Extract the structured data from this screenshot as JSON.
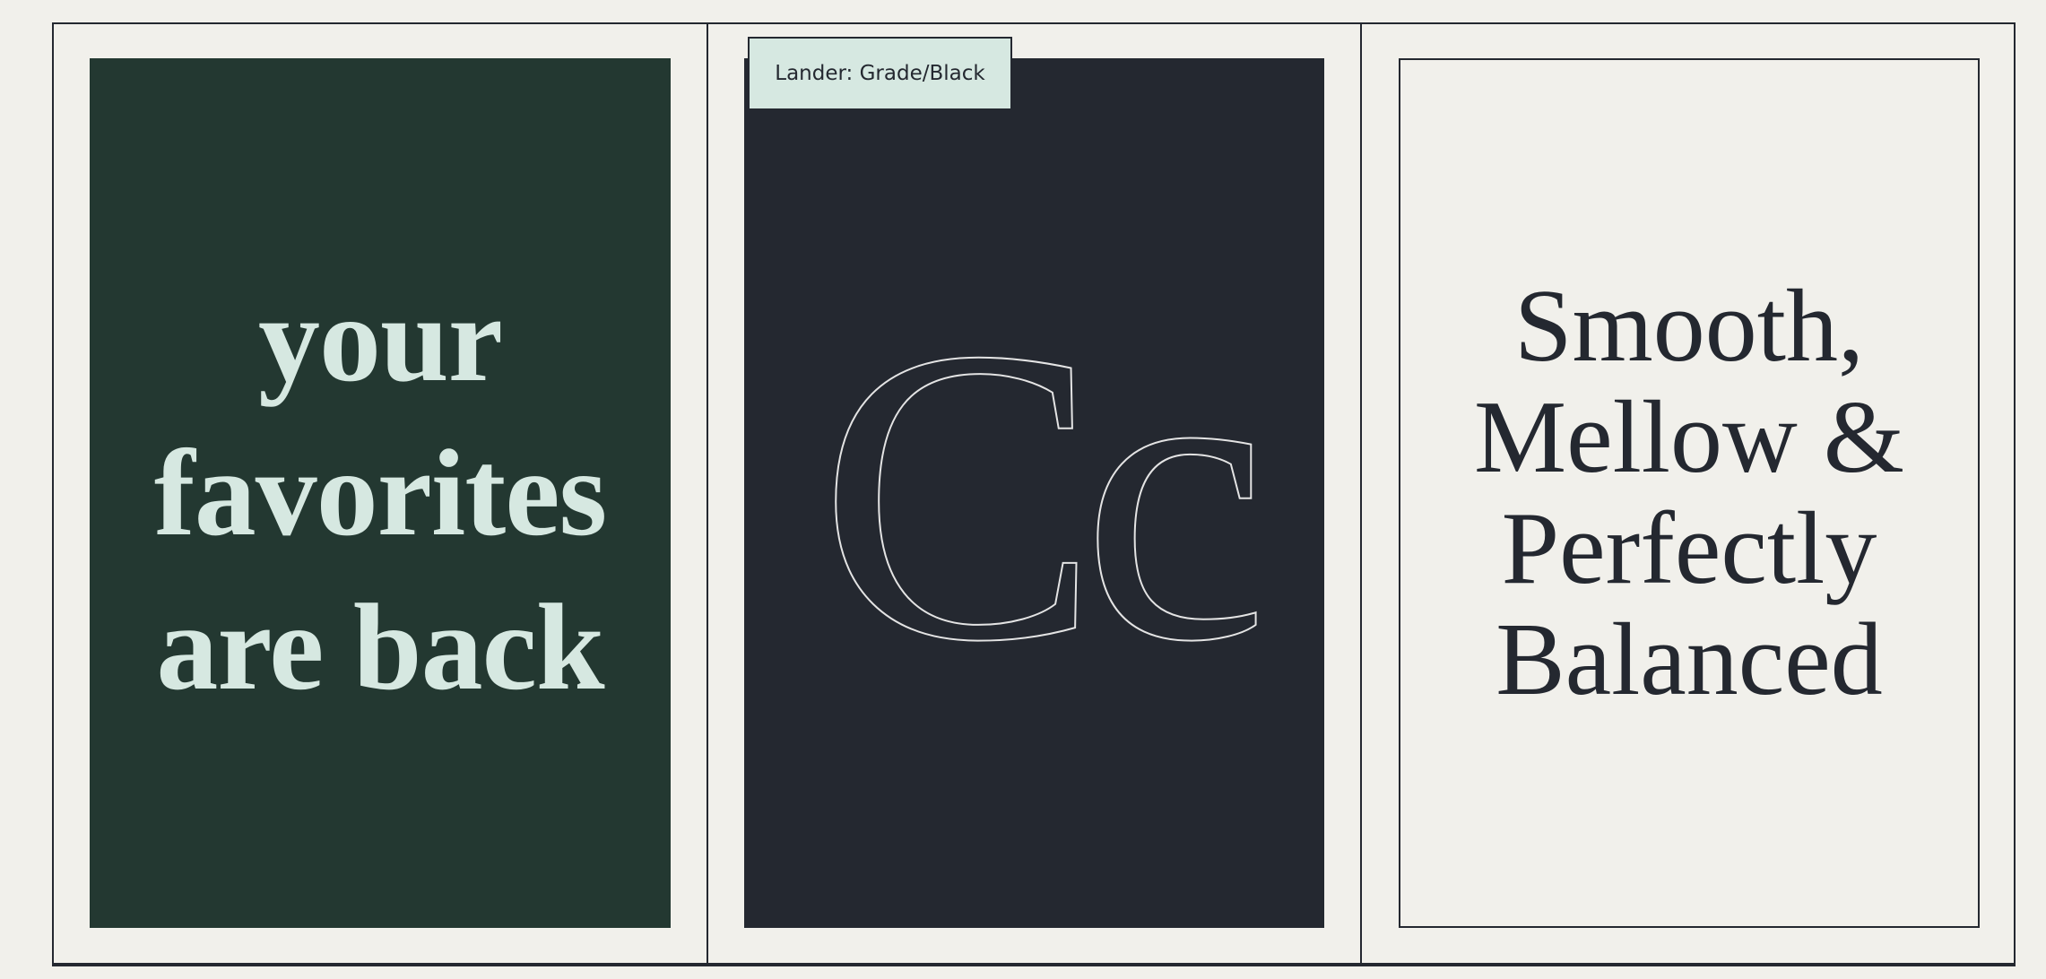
{
  "panels": [
    {
      "headline_lines": [
        "your",
        "favorites",
        "are back"
      ],
      "background": "#233831",
      "text_color": "#d6e8e1"
    },
    {
      "label": "Lander: Grade/Black",
      "glyphs": "Cc",
      "background": "#242830",
      "label_background": "#d6e8e1"
    },
    {
      "headline_lines": [
        "Smooth,",
        "Mellow &",
        "Perfectly",
        "Balanced"
      ],
      "background": "#f1f0eb",
      "text_color": "#242830"
    }
  ]
}
